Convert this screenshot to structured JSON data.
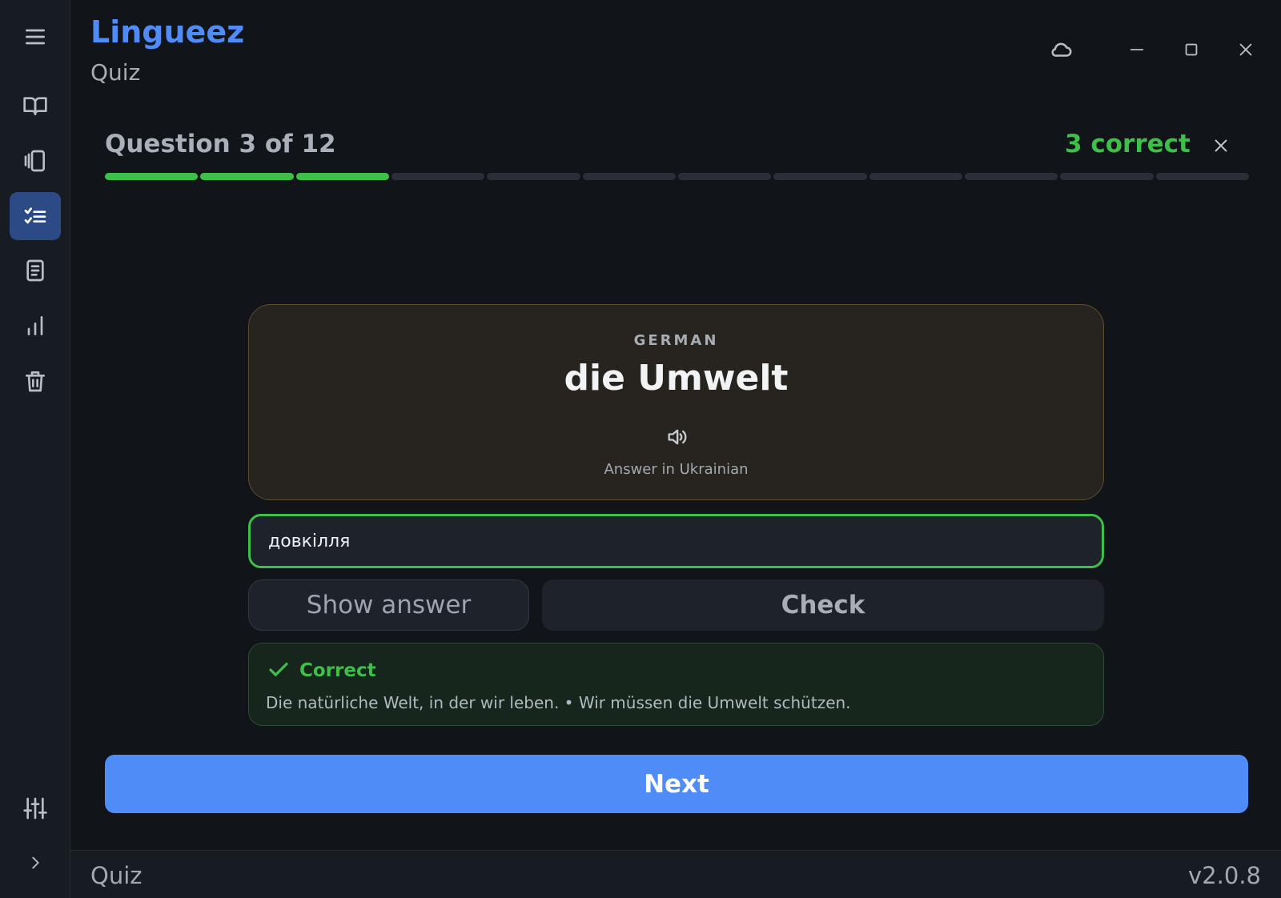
{
  "app": {
    "title": "Lingueez",
    "subtitle": "Quiz"
  },
  "sidebar": {
    "items": [
      {
        "icon": "menu-icon"
      },
      {
        "icon": "open-book-icon"
      },
      {
        "icon": "flashcards-icon"
      },
      {
        "icon": "quiz-checklist-icon",
        "active": true
      },
      {
        "icon": "document-icon"
      },
      {
        "icon": "bar-chart-icon"
      },
      {
        "icon": "trash-icon"
      },
      {
        "icon": "sliders-icon"
      },
      {
        "icon": "chevron-right-icon"
      }
    ]
  },
  "window_controls": [
    "cloud-icon",
    "minimize-icon",
    "maximize-icon",
    "close-icon"
  ],
  "quiz": {
    "question_label": "Question 3 of 12",
    "correct_label": "3 correct",
    "progress": {
      "completed": 3,
      "total": 12
    }
  },
  "card": {
    "language": "GERMAN",
    "word": "die Umwelt",
    "hint": "Answer in Ukrainian"
  },
  "answer": {
    "value": "довкілля"
  },
  "buttons": {
    "show_answer": "Show answer",
    "check": "Check",
    "next": "Next"
  },
  "feedback": {
    "title": "Correct",
    "text": "Die natürliche Welt, in der wir leben. • Wir müssen die Umwelt schützen."
  },
  "statusbar": {
    "left": "Quiz",
    "version": "v2.0.8"
  },
  "colors": {
    "accent": "#4f8cf7",
    "success": "#3dbf4a",
    "background": "#111418"
  }
}
